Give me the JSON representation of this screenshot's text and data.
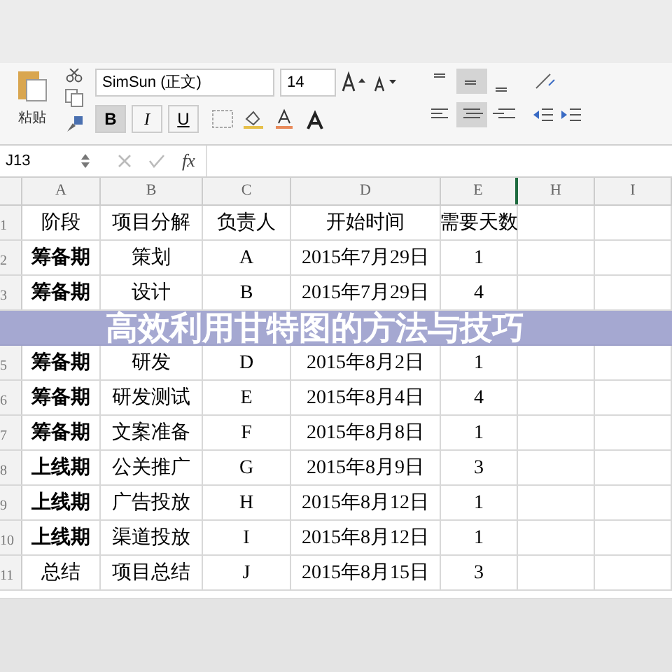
{
  "toolbar": {
    "paste_label": "粘贴",
    "font_name": "SimSun (正文)",
    "font_size": "14",
    "style_buttons": [
      {
        "label": "B",
        "selected": true
      },
      {
        "label": "I",
        "selected": false
      },
      {
        "label": "U",
        "selected": false
      }
    ],
    "align_top": [
      {
        "selected": false
      },
      {
        "selected": true
      },
      {
        "selected": false
      }
    ],
    "align_bottom": [
      {
        "selected": false
      },
      {
        "selected": true
      },
      {
        "selected": false
      }
    ]
  },
  "formula_bar": {
    "cell_ref": "J13",
    "fx": "fx"
  },
  "columns": [
    "A",
    "B",
    "C",
    "D",
    "E",
    "H",
    "I"
  ],
  "rows": [
    {
      "number": "1",
      "bold": false,
      "cells": [
        "阶段",
        "项目分解",
        "负责人",
        "开始时间",
        "需要天数"
      ]
    },
    {
      "number": "2",
      "bold": true,
      "cells": [
        "筹备期",
        "策划",
        "A",
        "2015年7月29日",
        "1"
      ]
    },
    {
      "number": "3",
      "bold": true,
      "cells": [
        "筹备期",
        "设计",
        "B",
        "2015年7月29日",
        "4"
      ]
    },
    {
      "covered": true
    },
    {
      "number": "5",
      "bold": true,
      "cells": [
        "筹备期",
        "研发",
        "D",
        "2015年8月2日",
        "1"
      ]
    },
    {
      "number": "6",
      "bold": true,
      "cells": [
        "筹备期",
        "研发测试",
        "E",
        "2015年8月4日",
        "4"
      ]
    },
    {
      "number": "7",
      "bold": true,
      "cells": [
        "筹备期",
        "文案准备",
        "F",
        "2015年8月8日",
        "1"
      ]
    },
    {
      "number": "8",
      "bold": true,
      "cells": [
        "上线期",
        "公关推广",
        "G",
        "2015年8月9日",
        "3"
      ]
    },
    {
      "number": "9",
      "bold": true,
      "cells": [
        "上线期",
        "广告投放",
        "H",
        "2015年8月12日",
        "1"
      ]
    },
    {
      "number": "10",
      "bold": true,
      "cells": [
        "上线期",
        "渠道投放",
        "I",
        "2015年8月12日",
        "1"
      ]
    },
    {
      "number": "11",
      "bold": false,
      "cells": [
        "总结",
        "项目总结",
        "J",
        "2015年8月15日",
        "3"
      ]
    }
  ],
  "banner": {
    "title": "高效利用甘特图的方法与技巧"
  }
}
